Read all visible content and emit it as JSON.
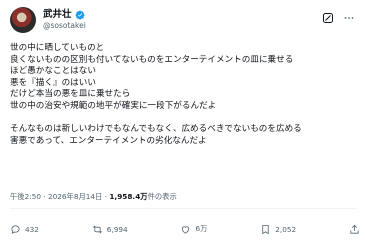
{
  "author": {
    "name": "武井壮",
    "handle": "@sosotakei"
  },
  "post": {
    "lines": [
      "世の中に晒していものと",
      "良くないものの区別も付いてないものをエンターテイメントの皿に乗せる",
      "ほど愚かなことはない",
      "悪を『描く』のはいい",
      "だけど本当の悪を皿に乗せたら",
      "世の中の治安や規範の地平が確実に一段下がるんだよ",
      "",
      "そんなものは新しいわけでもなんでもなく、広めるべきでないものを広める",
      "害悪であって、エンターテイメントの劣化なんだよ"
    ]
  },
  "meta": {
    "time": "午後2:50",
    "separator": "·",
    "date": "2026年8月14日",
    "views_count": "1,958.4万",
    "views_label": "件の表示"
  },
  "actions": {
    "reply_count": "432",
    "repost_count": "6,994",
    "like_count": "6万",
    "bookmark_count": "2,052"
  },
  "colors": {
    "verified": "#1d9bf0",
    "secondary_text": "#536471",
    "primary_text": "#0f1419"
  },
  "icons": [
    "verified-badge-icon",
    "grok-icon",
    "more-icon",
    "reply-icon",
    "repost-icon",
    "like-icon",
    "bookmark-icon",
    "share-icon"
  ]
}
